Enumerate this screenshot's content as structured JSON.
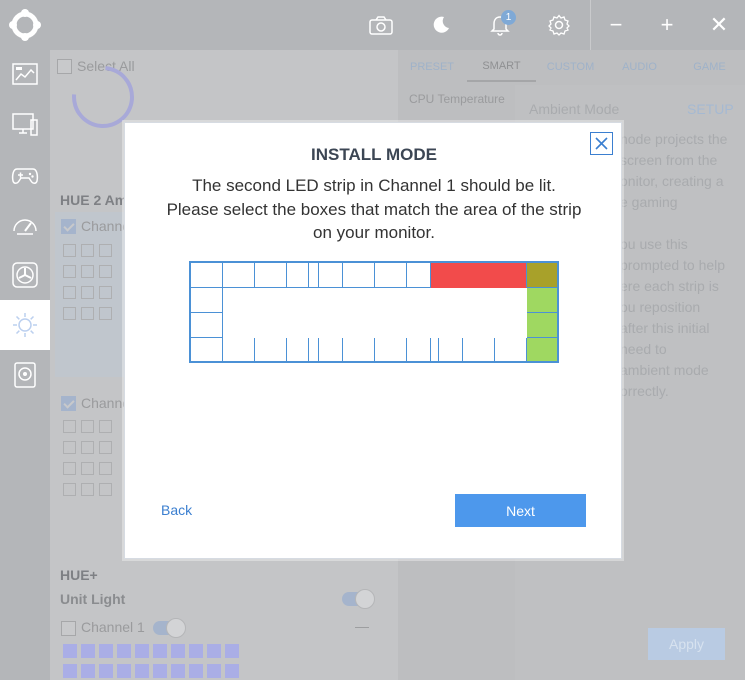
{
  "titlebar": {
    "notification_count": "1",
    "minimize_label": "−",
    "maximize_label": "+",
    "close_label": "✕"
  },
  "sidebar": {
    "items": [
      {
        "icon": "dashboard-icon"
      },
      {
        "icon": "pc-icon"
      },
      {
        "icon": "gamepad-icon"
      },
      {
        "icon": "gauge-icon"
      },
      {
        "icon": "fan-icon"
      },
      {
        "icon": "lighting-icon",
        "active": true
      },
      {
        "icon": "camera-device-icon"
      }
    ]
  },
  "left_panel": {
    "select_all_label": "Select All",
    "hue2_heading": "HUE 2 Am",
    "channel_a_label": "Channe",
    "channel_b_label": "Channe",
    "hue_plus_heading": "HUE+",
    "unit_light_label": "Unit Light",
    "channel1_label": "Channel 1",
    "collapse_label": "—"
  },
  "tabs": [
    "PRESET",
    "SMART",
    "CUSTOM",
    "AUDIO",
    "GAME"
  ],
  "selected_tab": "SMART",
  "mode_list": {
    "item_label": "CPU Temperature"
  },
  "ambient": {
    "title": "Ambient Mode",
    "setup_label": "SETUP",
    "description_lines": [
      "node projects the",
      "screen from the",
      "onitor, creating a",
      "e gaming",
      "",
      "ou use this",
      "prompted to help",
      "ere each strip is",
      "ou reposition",
      "after this initial",
      "need to",
      "ambient mode",
      "orrectly."
    ],
    "apply_label": "Apply"
  },
  "modal": {
    "title": "INSTALL MODE",
    "message": "The second LED strip in Channel 1 should be lit. Please select the boxes that match the area of the strip on your monitor.",
    "back_label": "Back",
    "next_label": "Next",
    "colors": {
      "lit_red": "#f24b4b",
      "selected_green": "#9fd861",
      "overlap_olive": "#a8a12a",
      "border_blue": "#4b91d6",
      "accent_blue": "#4d98ec"
    }
  }
}
